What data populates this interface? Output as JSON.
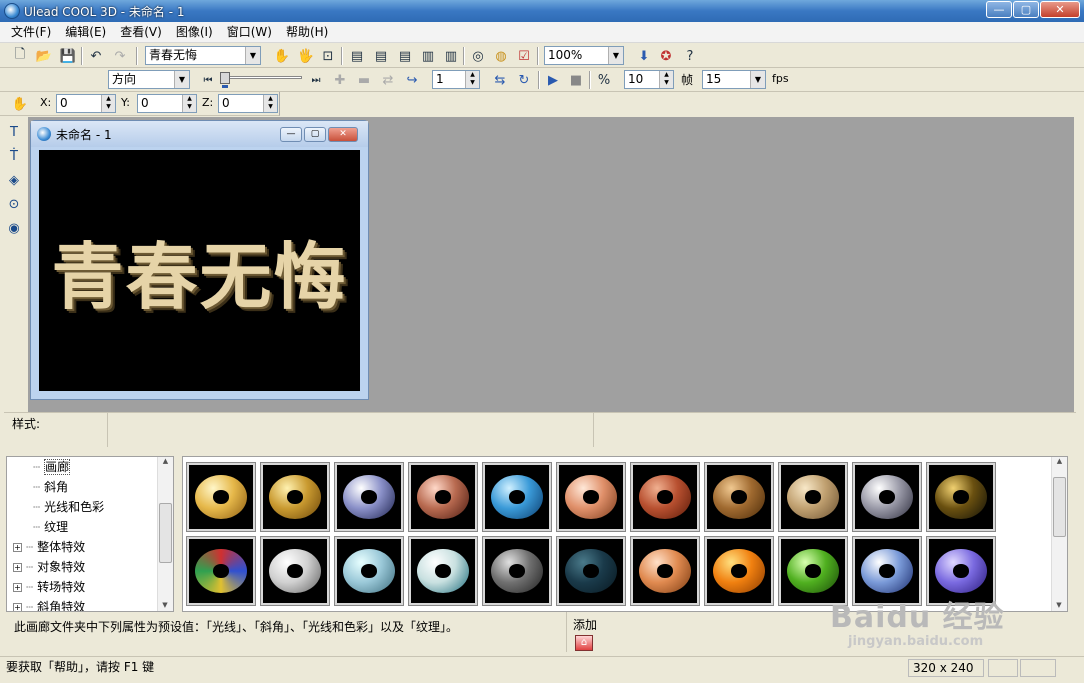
{
  "app": {
    "title": "Ulead COOL 3D - 未命名 - 1",
    "caption_buttons": [
      "—",
      "▢",
      "✕"
    ]
  },
  "menu": [
    "文件(F)",
    "编辑(E)",
    "查看(V)",
    "图像(I)",
    "窗口(W)",
    "帮助(H)"
  ],
  "toolbar1": {
    "text_combo": "青春无悔",
    "zoom_combo": "100%"
  },
  "toolbar2": {
    "direction_combo": "方向",
    "frame_value": "1",
    "frames_total": "10",
    "frame_label": "帧",
    "fps_value": "15",
    "fps_label": "fps"
  },
  "toolbar3": {
    "x_label": "X:",
    "x_value": "0",
    "y_label": "Y:",
    "y_value": "0",
    "z_label": "Z:",
    "z_value": "0"
  },
  "document": {
    "title": "未命名 - 1",
    "canvas_text": "青春无悔",
    "canvas_text_color": "#e6d4a8",
    "canvas_background": "#000000"
  },
  "style_panel": {
    "label": "样式:"
  },
  "tree": {
    "items": [
      {
        "label": "画廊",
        "expander": "",
        "selected": true
      },
      {
        "label": "斜角",
        "expander": "",
        "selected": false
      },
      {
        "label": "光线和色彩",
        "expander": "",
        "selected": false
      },
      {
        "label": "纹理",
        "expander": "",
        "selected": false
      },
      {
        "label": "整体特效",
        "expander": "+",
        "selected": false
      },
      {
        "label": "对象特效",
        "expander": "+",
        "selected": false
      },
      {
        "label": "转场特效",
        "expander": "+",
        "selected": false
      },
      {
        "label": "斜角特效",
        "expander": "+",
        "selected": false
      }
    ]
  },
  "gallery": {
    "thumbnails": [
      {
        "name": "gold"
      },
      {
        "name": "gold-ring"
      },
      {
        "name": "silver-blue"
      },
      {
        "name": "copper"
      },
      {
        "name": "blue-ice"
      },
      {
        "name": "peach"
      },
      {
        "name": "red-stone"
      },
      {
        "name": "brown-pattern"
      },
      {
        "name": "tan-mosaic"
      },
      {
        "name": "gray-camo"
      },
      {
        "name": "black-gold"
      },
      {
        "name": "stained-glass"
      },
      {
        "name": "white-metal"
      },
      {
        "name": "glass-blue"
      },
      {
        "name": "white-teal"
      },
      {
        "name": "gray-dots"
      },
      {
        "name": "dark-teal"
      },
      {
        "name": "orange-peach"
      },
      {
        "name": "orange-bright"
      },
      {
        "name": "green"
      },
      {
        "name": "blue-silver"
      },
      {
        "name": "violet"
      }
    ]
  },
  "description": {
    "text": "此画廊文件夹中下列属性为预设值：「光线」、「斜角」、「光线和色彩」以及「纹理」。",
    "add_label": "添加"
  },
  "statusbar": {
    "text": "要获取「帮助」，请按 F1 键",
    "size": "320 x 240"
  },
  "watermark": {
    "line1": "Baidu 经验",
    "line2": "jingyan.baidu.com"
  }
}
